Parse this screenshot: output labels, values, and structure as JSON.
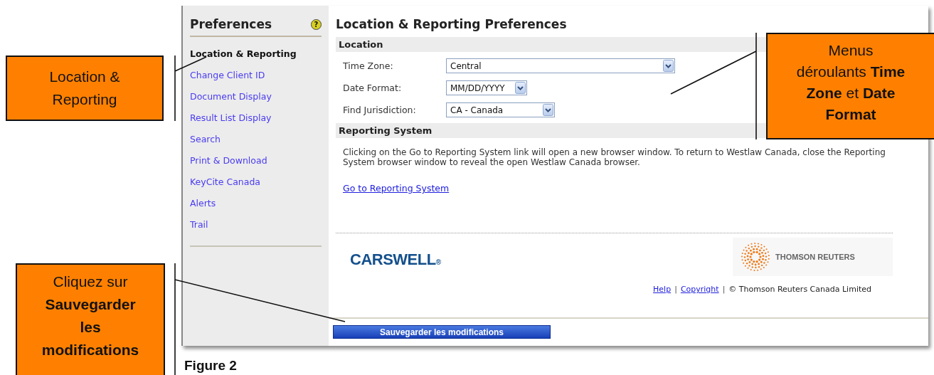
{
  "sidebar": {
    "title": "Preferences",
    "help_glyph": "?",
    "items": [
      {
        "label": "Location & Reporting",
        "selected": true
      },
      {
        "label": "Change Client ID",
        "selected": false
      },
      {
        "label": "Document Display",
        "selected": false
      },
      {
        "label": "Result List Display",
        "selected": false
      },
      {
        "label": "Search",
        "selected": false
      },
      {
        "label": "Print & Download",
        "selected": false
      },
      {
        "label": "KeyCite Canada",
        "selected": false
      },
      {
        "label": "Alerts",
        "selected": false
      },
      {
        "label": "Trail",
        "selected": false
      }
    ]
  },
  "main": {
    "title": "Location & Reporting Preferences",
    "sections": [
      {
        "heading": "Location",
        "fields": [
          {
            "label": "Time Zone:",
            "value": "Central"
          },
          {
            "label": "Date Format:",
            "value": "MM/DD/YYYY"
          },
          {
            "label": "Find Jurisdiction:",
            "value": "CA - Canada"
          }
        ]
      },
      {
        "heading": "Reporting System",
        "text": "Clicking on the Go to Reporting System link will open a new browser window. To return to Westlaw Canada, close the Reporting System browser window to reveal the open Westlaw Canada browser.",
        "link": "Go to Reporting System"
      }
    ]
  },
  "footer": {
    "carswell_logo": "CARSWELL",
    "carswell_mark": "®",
    "reuters_logo": "THOMSON REUTERS",
    "items": [
      {
        "kind": "link",
        "text": "Help"
      },
      {
        "kind": "separator",
        "text": "|"
      },
      {
        "kind": "link",
        "text": "Copyright"
      },
      {
        "kind": "separator",
        "text": "|"
      },
      {
        "kind": "text",
        "text": "© Thomson Reuters Canada Limited"
      }
    ]
  },
  "save_button": "Sauvegarder les modifications",
  "callouts": [
    {
      "text": "Location & Reporting"
    },
    {
      "text": "Menus déroulants **Time Zone** et **Date Format**"
    },
    {
      "text": "Cliquez sur **Sauvegarder les modifications**"
    }
  ],
  "figure_caption": "Figure 2"
}
